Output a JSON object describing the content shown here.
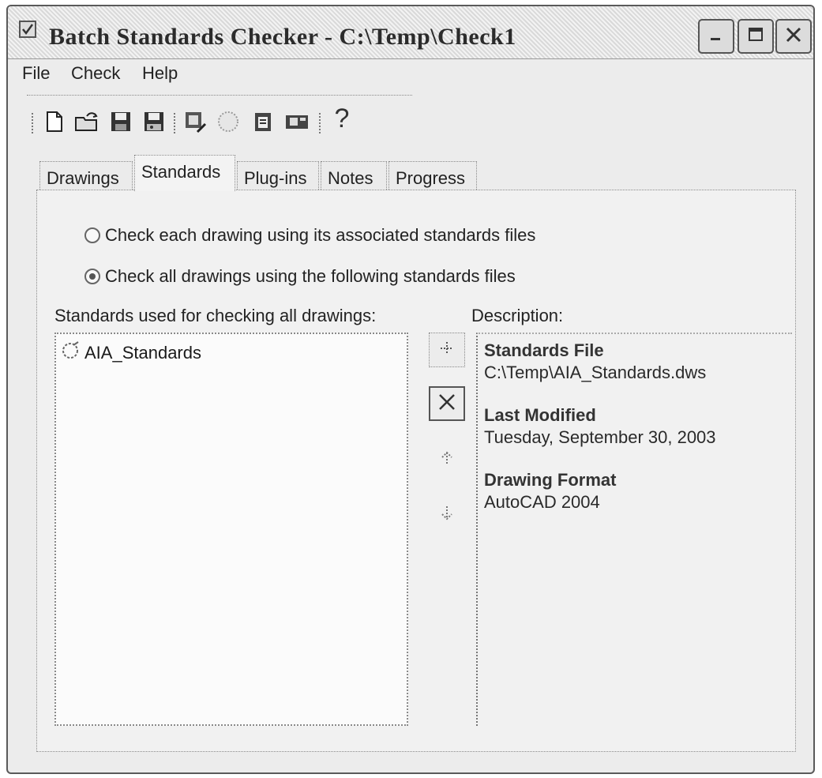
{
  "window": {
    "title": "Batch Standards Checker - C:\\Temp\\Check1"
  },
  "menu": [
    "File",
    "Check",
    "Help"
  ],
  "toolbar": {
    "icons": [
      "new-file-icon",
      "open-folder-icon",
      "save-icon",
      "save-as-icon",
      "check-drawings-icon",
      "stop-icon",
      "view-report-icon",
      "export-report-icon",
      "help-icon"
    ],
    "help_glyph": "?"
  },
  "tabs": [
    {
      "label": "Drawings",
      "active": false
    },
    {
      "label": "Standards",
      "active": true
    },
    {
      "label": "Plug-ins",
      "active": false
    },
    {
      "label": "Notes",
      "active": false
    },
    {
      "label": "Progress",
      "active": false
    }
  ],
  "options": {
    "associated": "Check each drawing using its associated standards files",
    "following": "Check all drawings using the following standards files",
    "selected": "following"
  },
  "standards_list": {
    "label": "Standards used for checking all drawings:",
    "items": [
      "AIA_Standards"
    ]
  },
  "description": {
    "label": "Description:",
    "standards_file_heading": "Standards File",
    "standards_file_value": "C:\\Temp\\AIA_Standards.dws",
    "last_modified_heading": "Last Modified",
    "last_modified_value": "Tuesday, September 30, 2003",
    "drawing_format_heading": "Drawing Format",
    "drawing_format_value": "AutoCAD 2004"
  }
}
